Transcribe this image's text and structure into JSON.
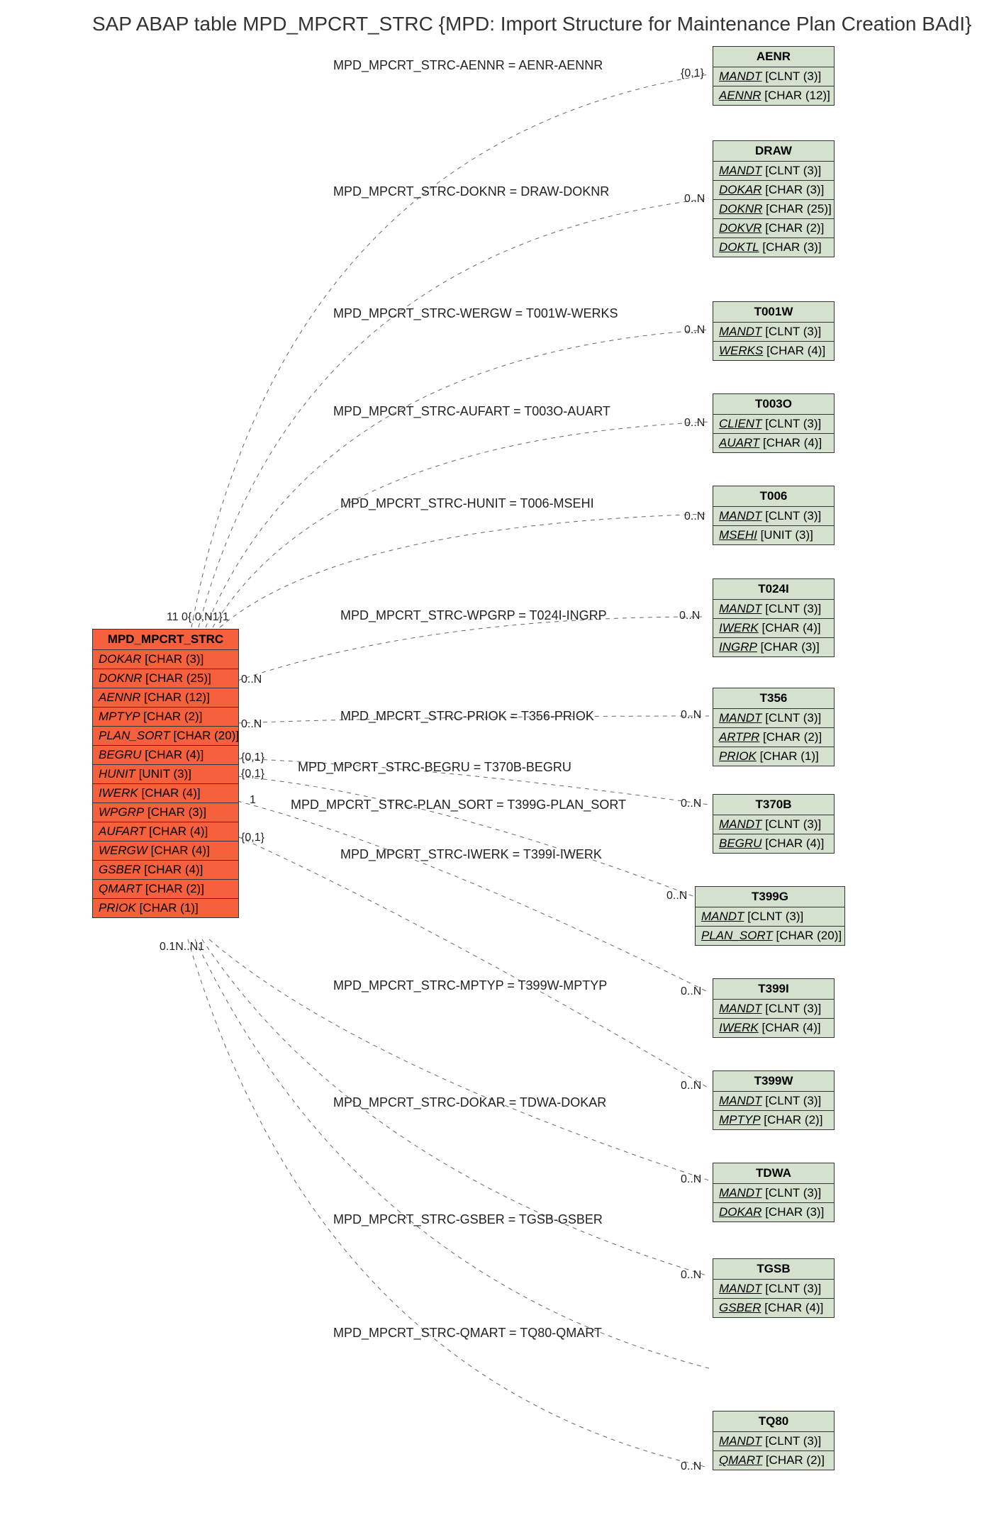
{
  "title": "SAP ABAP table MPD_MPCRT_STRC {MPD: Import Structure for Maintenance Plan Creation BAdI}",
  "main": {
    "name": "MPD_MPCRT_STRC",
    "fields": [
      {
        "name": "DOKAR",
        "type": "[CHAR (3)]"
      },
      {
        "name": "DOKNR",
        "type": "[CHAR (25)]"
      },
      {
        "name": "AENNR",
        "type": "[CHAR (12)]"
      },
      {
        "name": "MPTYP",
        "type": "[CHAR (2)]"
      },
      {
        "name": "PLAN_SORT",
        "type": "[CHAR (20)]"
      },
      {
        "name": "BEGRU",
        "type": "[CHAR (4)]"
      },
      {
        "name": "HUNIT",
        "type": "[UNIT (3)]"
      },
      {
        "name": "IWERK",
        "type": "[CHAR (4)]"
      },
      {
        "name": "WPGRP",
        "type": "[CHAR (3)]"
      },
      {
        "name": "AUFART",
        "type": "[CHAR (4)]"
      },
      {
        "name": "WERGW",
        "type": "[CHAR (4)]"
      },
      {
        "name": "GSBER",
        "type": "[CHAR (4)]"
      },
      {
        "name": "QMART",
        "type": "[CHAR (2)]"
      },
      {
        "name": "PRIOK",
        "type": "[CHAR (1)]"
      }
    ]
  },
  "targets": [
    {
      "name": "AENR",
      "fields": [
        {
          "name": "MANDT",
          "type": "[CLNT (3)]",
          "u": true
        },
        {
          "name": "AENNR",
          "type": "[CHAR (12)]",
          "u": true
        }
      ]
    },
    {
      "name": "DRAW",
      "fields": [
        {
          "name": "MANDT",
          "type": "[CLNT (3)]",
          "u": true
        },
        {
          "name": "DOKAR",
          "type": "[CHAR (3)]",
          "u": true
        },
        {
          "name": "DOKNR",
          "type": "[CHAR (25)]",
          "u": true
        },
        {
          "name": "DOKVR",
          "type": "[CHAR (2)]",
          "u": true
        },
        {
          "name": "DOKTL",
          "type": "[CHAR (3)]",
          "u": true
        }
      ]
    },
    {
      "name": "T001W",
      "fields": [
        {
          "name": "MANDT",
          "type": "[CLNT (3)]",
          "u": true
        },
        {
          "name": "WERKS",
          "type": "[CHAR (4)]",
          "u": true
        }
      ]
    },
    {
      "name": "T003O",
      "fields": [
        {
          "name": "CLIENT",
          "type": "[CLNT (3)]",
          "u": true
        },
        {
          "name": "AUART",
          "type": "[CHAR (4)]",
          "u": true
        }
      ]
    },
    {
      "name": "T006",
      "fields": [
        {
          "name": "MANDT",
          "type": "[CLNT (3)]",
          "u": true
        },
        {
          "name": "MSEHI",
          "type": "[UNIT (3)]",
          "u": true
        }
      ]
    },
    {
      "name": "T024I",
      "fields": [
        {
          "name": "MANDT",
          "type": "[CLNT (3)]",
          "u": true
        },
        {
          "name": "IWERK",
          "type": "[CHAR (4)]",
          "u": true
        },
        {
          "name": "INGRP",
          "type": "[CHAR (3)]",
          "u": true
        }
      ]
    },
    {
      "name": "T356",
      "fields": [
        {
          "name": "MANDT",
          "type": "[CLNT (3)]",
          "u": true
        },
        {
          "name": "ARTPR",
          "type": "[CHAR (2)]",
          "u": true
        },
        {
          "name": "PRIOK",
          "type": "[CHAR (1)]",
          "u": true
        }
      ]
    },
    {
      "name": "T370B",
      "fields": [
        {
          "name": "MANDT",
          "type": "[CLNT (3)]",
          "u": true
        },
        {
          "name": "BEGRU",
          "type": "[CHAR (4)]",
          "u": true
        }
      ]
    },
    {
      "name": "T399G",
      "fields": [
        {
          "name": "MANDT",
          "type": "[CLNT (3)]",
          "u": true
        },
        {
          "name": "PLAN_SORT",
          "type": "[CHAR (20)]",
          "u": true
        }
      ]
    },
    {
      "name": "T399I",
      "fields": [
        {
          "name": "MANDT",
          "type": "[CLNT (3)]",
          "u": true
        },
        {
          "name": "IWERK",
          "type": "[CHAR (4)]",
          "u": true
        }
      ]
    },
    {
      "name": "T399W",
      "fields": [
        {
          "name": "MANDT",
          "type": "[CLNT (3)]",
          "u": true
        },
        {
          "name": "MPTYP",
          "type": "[CHAR (2)]",
          "u": true
        }
      ]
    },
    {
      "name": "TDWA",
      "fields": [
        {
          "name": "MANDT",
          "type": "[CLNT (3)]",
          "u": true
        },
        {
          "name": "DOKAR",
          "type": "[CHAR (3)]",
          "u": true
        }
      ]
    },
    {
      "name": "TGSB",
      "fields": [
        {
          "name": "MANDT",
          "type": "[CLNT (3)]",
          "u": true
        },
        {
          "name": "GSBER",
          "type": "[CHAR (4)]",
          "u": true
        }
      ]
    },
    {
      "name": "TQ80",
      "fields": [
        {
          "name": "MANDT",
          "type": "[CLNT (3)]",
          "u": true
        },
        {
          "name": "QMART",
          "type": "[CHAR (2)]",
          "u": true
        }
      ]
    }
  ],
  "relations": [
    {
      "label": "MPD_MPCRT_STRC-AENNR = AENR-AENNR",
      "leftCard": "{0,1}",
      "rightCard": "{0,1}"
    },
    {
      "label": "MPD_MPCRT_STRC-DOKNR = DRAW-DOKNR",
      "leftCard": "0..N1",
      "rightCard": "0..N"
    },
    {
      "label": "MPD_MPCRT_STRC-WERGW = T001W-WERKS",
      "leftCard": "0..N",
      "rightCard": "0..N"
    },
    {
      "label": "MPD_MPCRT_STRC-AUFART = T003O-AUART",
      "leftCard": "11",
      "rightCard": "0..N"
    },
    {
      "label": "MPD_MPCRT_STRC-HUNIT = T006-MSEHI",
      "leftCard": "0..N",
      "rightCard": "0..N"
    },
    {
      "label": "MPD_MPCRT_STRC-WPGRP = T024I-INGRP",
      "leftCard": "0..N",
      "rightCard": "0..N"
    },
    {
      "label": "MPD_MPCRT_STRC-PRIOK = T356-PRIOK",
      "leftCard": "0..N",
      "rightCard": "0..N"
    },
    {
      "label": "MPD_MPCRT_STRC-BEGRU = T370B-BEGRU",
      "leftCard": "{0,1}",
      "rightCard": "0..N"
    },
    {
      "label": "MPD_MPCRT_STRC-PLAN_SORT = T399G-PLAN_SORT",
      "leftCard": "{0,1}",
      "rightCard": "0..N"
    },
    {
      "label": "MPD_MPCRT_STRC-IWERK = T399I-IWERK",
      "leftCard": "1",
      "rightCard": "0..N"
    },
    {
      "label": "MPD_MPCRT_STRC-MPTYP = T399W-MPTYP",
      "leftCard": "{0,1}",
      "rightCard": "0..N"
    },
    {
      "label": "MPD_MPCRT_STRC-DOKAR = TDWA-DOKAR",
      "leftCard": "0..N",
      "rightCard": "0..N"
    },
    {
      "label": "MPD_MPCRT_STRC-GSBER = TGSB-GSBER",
      "leftCard": "0..N1",
      "rightCard": "0..N"
    },
    {
      "label": "MPD_MPCRT_STRC-QMART = TQ80-QMART",
      "leftCard": "11",
      "rightCard": "0..N"
    }
  ],
  "leftCardGroup": "11  0{.0,N1}1",
  "bottomCardGroup": "0.1N..N1"
}
